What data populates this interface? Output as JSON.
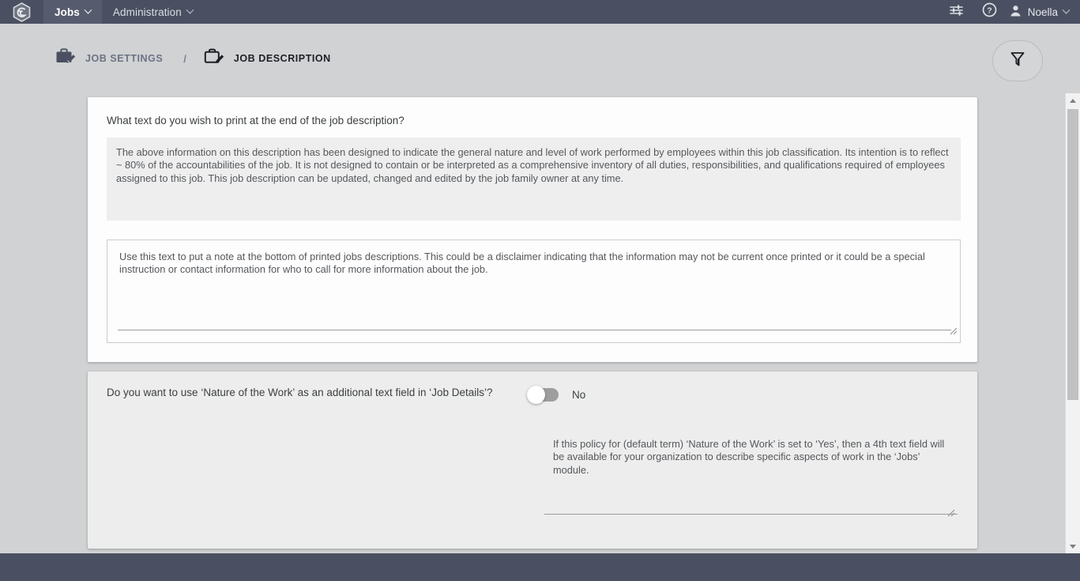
{
  "topbar": {
    "logo_icon": "hexagon-logo-icon",
    "tabs": [
      {
        "label": "Jobs",
        "active": true
      },
      {
        "label": "Administration",
        "active": false
      }
    ],
    "settings_icon": "sliders-icon",
    "help_icon": "question-circle-icon",
    "avatar_icon": "user-avatar-icon",
    "user_name": "Noella"
  },
  "breadcrumb": {
    "parent_icon": "briefcase-edit-icon",
    "parent_label": "JOB SETTINGS",
    "separator": "/",
    "current_icon": "briefcase-edit-outline-icon",
    "current_label": "JOB DESCRIPTION"
  },
  "filter_button": {
    "icon": "filter-funnel-icon",
    "label": ""
  },
  "card_print_text": {
    "question": "What text do you wish to print at the end of the job description?",
    "footer_text_value": "The above information on this description has been designed to indicate the general nature and level of work performed by employees within this job classification. Its intention is to reflect ~ 80% of the accountabilities of the job. It is not designed to contain or be interpreted as a comprehensive inventory of all duties, responsibilities, and qualifications required of employees assigned to this job. This job description can be updated, changed and edited by the job family owner at any time.",
    "footer_text_placeholder": "",
    "help_text_value": "Use this text to put a note at the bottom of printed jobs descriptions. This could be a disclaimer indicating that the information may not be current once printed or it could be a special instruction or contact information for who to call for more information about the job.",
    "help_text_placeholder": ""
  },
  "card_nature_of_work": {
    "question": "Do you want to use ‘Nature of the Work’ as an additional text field in ‘Job Details’?",
    "toggle_state": "off",
    "toggle_value_label": "No",
    "help_text_value": "If this policy for (default term) ‘Nature of the Work’ is set to ‘Yes’, then a 4th text field will be available for your organization to describe specific aspects of work in the ‘Jobs’ module.",
    "help_text_placeholder": ""
  },
  "scrollbar": {
    "up_icon": "scroll-up-arrow-icon",
    "down_icon": "scroll-down-arrow-icon"
  },
  "colors": {
    "navbar": "#4a5061",
    "navbar_active_tab": "#565c6e",
    "page_background": "#d0d2d4",
    "card_white": "#fdfdfd",
    "card_gray": "#ededed",
    "field_gray": "#eeeeee",
    "text_primary": "#3c4043",
    "text_secondary": "#55585c",
    "toggle_track_off": "#9e9e9e"
  }
}
